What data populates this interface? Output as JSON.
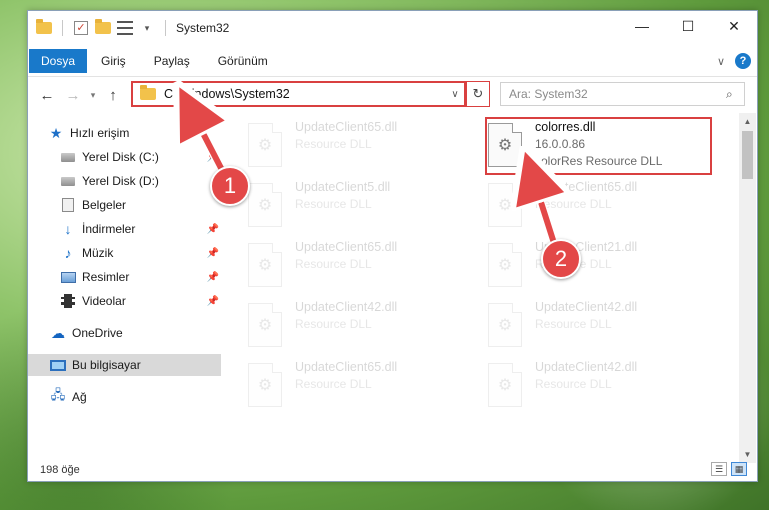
{
  "window": {
    "title": "System32",
    "controls": {
      "minimize": "—",
      "maximize": "☐",
      "close": "✕"
    }
  },
  "ribbon": {
    "file_tab": "Dosya",
    "tabs": [
      "Giriş",
      "Paylaş",
      "Görünüm"
    ]
  },
  "address": {
    "path": "C:\\Windows\\System32",
    "search_placeholder": "Ara: System32"
  },
  "sidebar": {
    "items": [
      {
        "label": "Hızlı erişim",
        "icon": "star-icon"
      },
      {
        "label": "Yerel Disk (C:)",
        "icon": "disk-icon"
      },
      {
        "label": "Yerel Disk (D:)",
        "icon": "disk-icon"
      },
      {
        "label": "Belgeler",
        "icon": "documents-icon"
      },
      {
        "label": "İndirmeler",
        "icon": "downloads-icon"
      },
      {
        "label": "Müzik",
        "icon": "music-icon"
      },
      {
        "label": "Resimler",
        "icon": "pictures-icon"
      },
      {
        "label": "Videolar",
        "icon": "videos-icon"
      },
      {
        "label": "OneDrive",
        "icon": "cloud-icon"
      },
      {
        "label": "Bu bilgisayar",
        "icon": "computer-icon"
      },
      {
        "label": "Ağ",
        "icon": "network-icon"
      }
    ]
  },
  "files": [
    {
      "name": "UpdateClient65.dll",
      "desc": "Resource DLL"
    },
    {
      "name": "colorres.dll",
      "version": "16.0.0.86",
      "desc": "colorRes Resource DLL"
    },
    {
      "name": "UpdateClient5.dll",
      "desc": "Resource DLL"
    },
    {
      "name": "UpdateClient65.dll",
      "desc": "Resource DLL"
    },
    {
      "name": "UpdateClient65.dll",
      "desc": "Resource DLL"
    },
    {
      "name": "UpdateClient21.dll",
      "desc": "Resource DLL"
    },
    {
      "name": "UpdateClient42.dll",
      "desc": "Resource DLL"
    },
    {
      "name": "UpdateClient42.dll",
      "desc": "Resource DLL"
    },
    {
      "name": "UpdateClient65.dll",
      "desc": "Resource DLL"
    },
    {
      "name": "UpdateClient42.dll",
      "desc": "Resource DLL"
    }
  ],
  "status": {
    "count": "198 öğe"
  },
  "annotations": {
    "step1": "1",
    "step2": "2",
    "color": "#e34848"
  }
}
